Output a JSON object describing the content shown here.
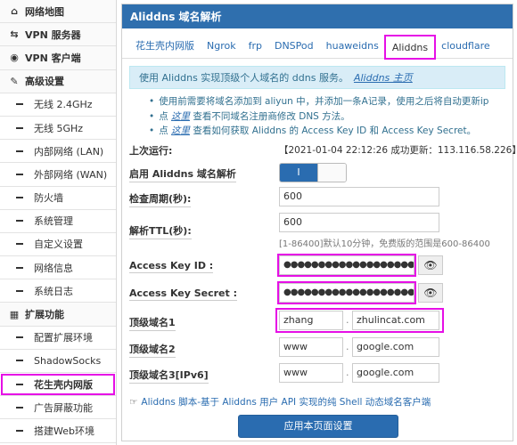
{
  "sidebar": {
    "items": [
      {
        "label": "网络地图",
        "type": "top",
        "icon": "home-icon"
      },
      {
        "label": "VPN 服务器",
        "type": "top",
        "icon": "vpn-server-icon"
      },
      {
        "label": "VPN 客户端",
        "type": "top",
        "icon": "globe-icon"
      },
      {
        "label": "高级设置",
        "type": "top",
        "icon": "wrench-icon"
      },
      {
        "label": "无线 2.4GHz",
        "type": "sub"
      },
      {
        "label": "无线 5GHz",
        "type": "sub"
      },
      {
        "label": "内部网络 (LAN)",
        "type": "sub"
      },
      {
        "label": "外部网络 (WAN)",
        "type": "sub"
      },
      {
        "label": "防火墙",
        "type": "sub"
      },
      {
        "label": "系统管理",
        "type": "sub"
      },
      {
        "label": "自定义设置",
        "type": "sub"
      },
      {
        "label": "网络信息",
        "type": "sub"
      },
      {
        "label": "系统日志",
        "type": "sub"
      },
      {
        "label": "扩展功能",
        "type": "top",
        "icon": "grid-icon"
      },
      {
        "label": "配置扩展环境",
        "type": "sub"
      },
      {
        "label": "ShadowSocks",
        "type": "sub"
      },
      {
        "label": "花生壳内网版",
        "type": "sub",
        "highlight": true
      },
      {
        "label": "广告屏蔽功能",
        "type": "sub"
      },
      {
        "label": "搭建Web环境",
        "type": "sub"
      }
    ]
  },
  "panel": {
    "title": "Aliddns 域名解析",
    "tabs": [
      "花生壳内网版",
      "Ngrok",
      "frp",
      "DNSPod",
      "huaweidns",
      "Aliddns",
      "cloudflare"
    ],
    "active_tab": "Aliddns"
  },
  "info": {
    "text": "使用 Aliddns 实现顶级个人域名的 ddns 服务。",
    "link": "Aliddns 主页"
  },
  "notes": {
    "n1": "使用前需要将域名添加到 aliyun 中，并添加一条A记录，使用之后将自动更新ip",
    "n2_pre": "点",
    "n2_link": "这里",
    "n2_post": "查看不同域名注册商修改 DNS 方法。",
    "n3_pre": "点",
    "n3_link": "这里",
    "n3_post": "查看如何获取 Aliddns 的 Access Key ID 和 Access Key Secret。"
  },
  "form": {
    "last_run_label": "上次运行:",
    "last_run_value": "【2021-01-04 22:12:26 成功更新：113.116.58.226】",
    "enable_label": "启用 Aliddns 域名解析",
    "enable_on_text": "I",
    "enabled": true,
    "interval_label": "检查周期(秒):",
    "interval_value": "600",
    "ttl_label": "解析TTL(秒):",
    "ttl_value": "600",
    "ttl_hint": "[1-86400]默认10分钟，免费版的范围是600-86400",
    "key_id_label": "Access Key ID :",
    "key_id_value": "●●●●●●●●●●●●●●●●●●●●●●●●",
    "key_secret_label": "Access Key Secret :",
    "key_secret_value": "●●●●●●●●●●●●●●●●●●●●●●●●●●●●●●",
    "domain1_label": "顶级域名1",
    "domain1_host": "zhang",
    "domain1_domain": "zhulincat.com",
    "domain2_label": "顶级域名2",
    "domain2_host": "www",
    "domain2_domain": "google.com",
    "domain3_label": "顶级域名3[IPv6]",
    "domain3_host": "www",
    "domain3_domain": "google.com",
    "dot": "."
  },
  "footer": {
    "note": "Aliddns 脚本-基于 Aliddns 用户 API 实现的纯 Shell 动态域名客户端",
    "save_label": "应用本页面设置"
  },
  "colors": {
    "header_blue": "#2f6fae",
    "accent_blue": "#2a6cb0",
    "highlight_magenta": "#e60fe6",
    "info_bg": "#d9edf7"
  }
}
